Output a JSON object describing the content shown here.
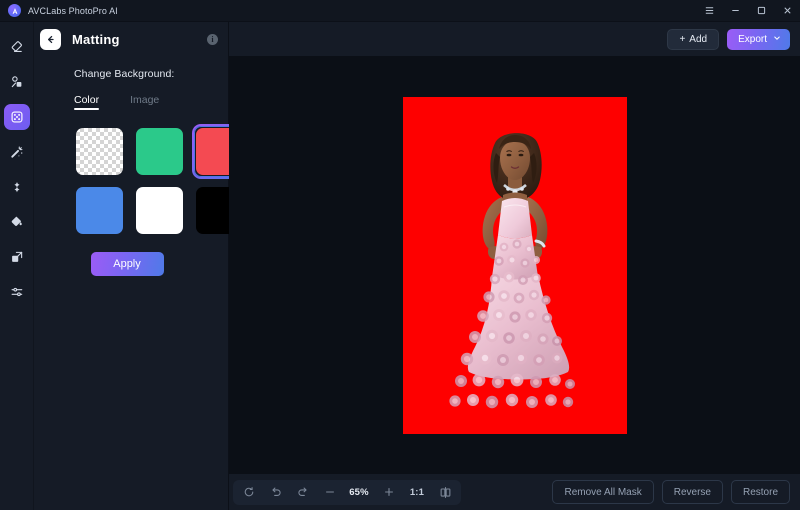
{
  "titlebar": {
    "app_name": "AVCLabs PhotoPro AI",
    "logo_icon": "app-logo-icon",
    "menu_icon": "hamburger-menu-icon",
    "minimize_icon": "minimize-icon",
    "maximize_icon": "maximize-icon",
    "close_icon": "close-icon"
  },
  "rail": {
    "items": [
      {
        "icon": "eraser-icon",
        "active": false
      },
      {
        "icon": "object-remove-icon",
        "active": false
      },
      {
        "icon": "matting-icon",
        "active": true
      },
      {
        "icon": "magic-wand-icon",
        "active": false
      },
      {
        "icon": "enhance-sparkle-icon",
        "active": false
      },
      {
        "icon": "paint-bucket-icon",
        "active": false
      },
      {
        "icon": "resize-icon",
        "active": false
      },
      {
        "icon": "adjust-sliders-icon",
        "active": false
      }
    ]
  },
  "panel": {
    "back_icon": "back-arrow-icon",
    "title": "Matting",
    "info_icon": "info-icon",
    "info_glyph": "i",
    "section_label": "Change Background:",
    "tabs": [
      {
        "label": "Color",
        "active": true
      },
      {
        "label": "Image",
        "active": false
      }
    ],
    "swatches": [
      {
        "name": "transparent",
        "color": "transparent",
        "selected": false
      },
      {
        "name": "green",
        "color": "#2bc98a",
        "selected": false
      },
      {
        "name": "red",
        "color": "#f44a52",
        "selected": true
      },
      {
        "name": "blue",
        "color": "#4b89e8",
        "selected": false
      },
      {
        "name": "white",
        "color": "#ffffff",
        "selected": false
      },
      {
        "name": "black",
        "color": "#000000",
        "selected": false
      }
    ],
    "apply_label": "Apply"
  },
  "header": {
    "add_label": "Add",
    "add_plus": "+",
    "add_icon": "plus-icon",
    "export_label": "Export",
    "export_chevron_icon": "chevron-down-icon"
  },
  "canvas": {
    "background_color": "#fe0000",
    "subject_alt": "woman in pink rose gown"
  },
  "bottombar": {
    "reset_icon": "reset-icon",
    "undo_icon": "undo-icon",
    "redo_icon": "redo-icon",
    "zoom_out_icon": "minus-icon",
    "zoom_level": "65%",
    "zoom_in_icon": "plus-icon",
    "fit_ratio_label": "1:1",
    "compare_icon": "compare-split-icon",
    "actions": [
      {
        "label": "Remove All Mask"
      },
      {
        "label": "Reverse"
      },
      {
        "label": "Restore"
      }
    ]
  },
  "colors": {
    "accent_purple": "#9b5cf6",
    "accent_blue": "#4f7ae8",
    "panel_bg": "#151b26",
    "canvas_bg": "#0b0f16",
    "titlebar_bg": "#11161f"
  }
}
